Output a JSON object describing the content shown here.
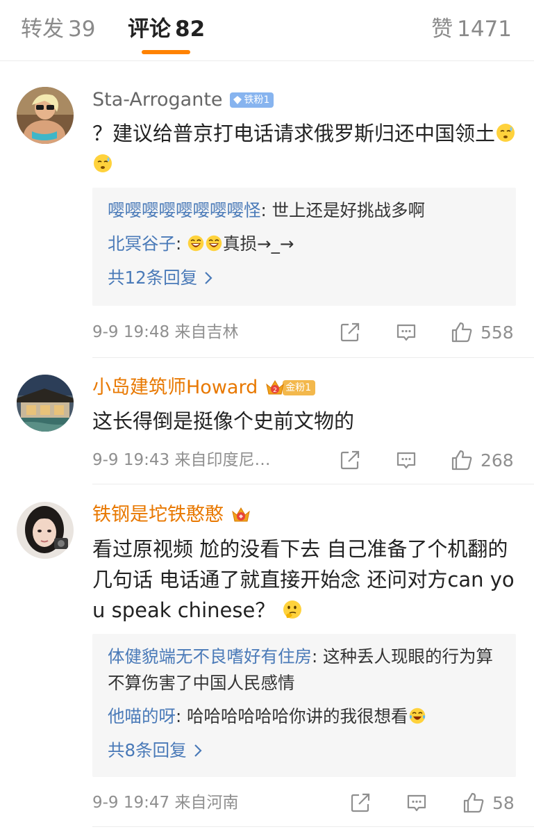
{
  "tabs": {
    "repost_label": "转发",
    "repost_count": "39",
    "comments_label": "评论",
    "comments_count": "82",
    "likes_label": "赞",
    "likes_count": "1471"
  },
  "colors": {
    "accent": "#ff8200",
    "link_blue": "#4a7ab8",
    "vip_orange": "#e87800"
  },
  "comments": [
    {
      "username": "Sta-Arrogante",
      "badge": "铁粉1",
      "text": "？建议给普京打电话请求俄罗斯归还中国领土",
      "emojis": [
        "sweat-face",
        "sweat-face"
      ],
      "replies": [
        {
          "name": "嘤嘤嘤嘤嘤嘤嘤嘤怪",
          "sep": ": ",
          "text": "世上还是好挑战多啊"
        },
        {
          "name": "北冥谷子",
          "sep": ": ",
          "text": "真损→_→",
          "emojis": [
            "laugh-face",
            "laugh-face"
          ]
        }
      ],
      "more": "共12条回复",
      "time": "9-9 19:48",
      "source": "来自吉林",
      "likes": "558"
    },
    {
      "username": "小岛建筑师Howard",
      "badge": "金粉1",
      "text": "这长得倒是挺像个史前文物的",
      "time": "9-9 19:43",
      "source": "来自印度尼…",
      "likes": "268"
    },
    {
      "username": "铁钢是坨铁憨憨",
      "text": "看过原视频 尬的没看下去 自己准备了个机翻的几句话 电话通了就直接开始念 还问对方can you speak chinese？",
      "emojis": [
        "thinking-face"
      ],
      "replies": [
        {
          "name": "体健貌端无不良嗜好有住房",
          "sep": ": ",
          "text": "这种丢人现眼的行为算不算伤害了中国人民感情"
        },
        {
          "name": "他喵的呀",
          "sep": ": ",
          "text": "哈哈哈哈哈哈你讲的我很想看",
          "emojis": [
            "tears-of-joy-face"
          ]
        }
      ],
      "more": "共8条回复",
      "time": "9-9 19:47",
      "source": "来自河南",
      "likes": "58"
    }
  ]
}
